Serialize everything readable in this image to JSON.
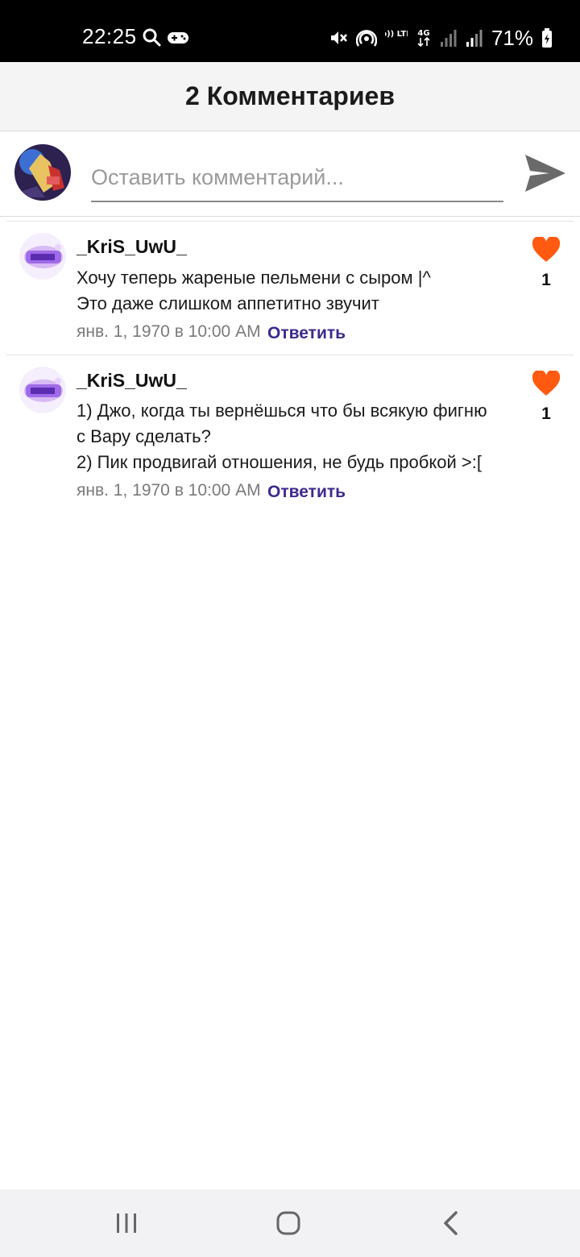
{
  "status_bar": {
    "time": "22:25",
    "battery_percent": "71%",
    "icons": [
      "search-icon",
      "gamepad-icon",
      "mute-icon",
      "hotspot-icon",
      "volte-icon",
      "4g-icon",
      "signal-icon",
      "signal-icon",
      "battery-icon"
    ],
    "network_labels": {
      "volte": "Vo)) LTE1",
      "data": "4G"
    }
  },
  "header": {
    "title": "2 Комментариев"
  },
  "composer": {
    "placeholder": "Оставить комментарий...",
    "value": "",
    "send_icon": "send-icon"
  },
  "comments": [
    {
      "author": "_KriS_UwU_",
      "lines": [
        "Хочу теперь жареные пельмени с сыром |^",
        "Это даже слишком аппетитно звучит"
      ],
      "date": "янв. 1, 1970 в 10:00 AM",
      "reply_label": "Ответить",
      "likes": "1"
    },
    {
      "author": "_KriS_UwU_",
      "lines": [
        "1) Джо, когда ты вернёшься что бы всякую фигню",
        "с Вару сделать?",
        "2) Пик продвигай отношения, не будь пробкой >:["
      ],
      "date": "янв. 1, 1970 в 10:00 AM",
      "reply_label": "Ответить",
      "likes": "1"
    }
  ],
  "colors": {
    "heart": "#ff5a10",
    "reply": "#3d2a8f",
    "header_bg": "#f4f4f5"
  },
  "nav_bar": {
    "icons": [
      "recents-icon",
      "home-icon",
      "back-icon"
    ]
  }
}
